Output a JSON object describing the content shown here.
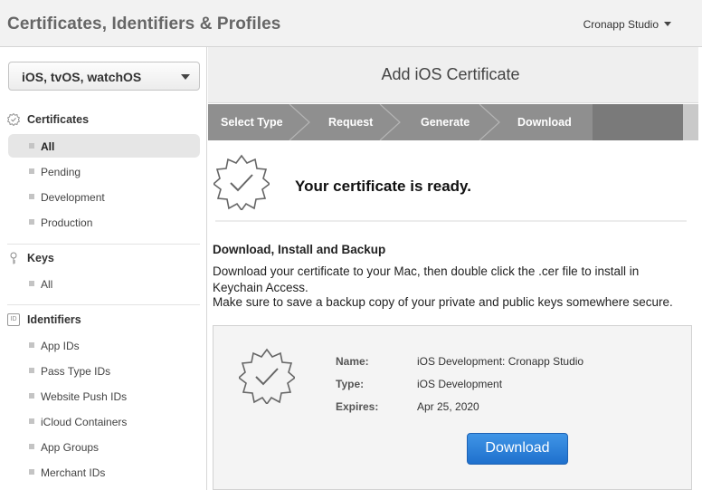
{
  "header": {
    "title": "Certificates, Identifiers & Profiles",
    "account": "Cronapp Studio"
  },
  "sidebar": {
    "platform": "iOS, tvOS, watchOS",
    "sections": {
      "certificates": {
        "title": "Certificates",
        "items": [
          "All",
          "Pending",
          "Development",
          "Production"
        ]
      },
      "keys": {
        "title": "Keys",
        "items": [
          "All"
        ]
      },
      "identifiers": {
        "title": "Identifiers",
        "icon_label": "ID",
        "items": [
          "App IDs",
          "Pass Type IDs",
          "Website Push IDs",
          "iCloud Containers",
          "App Groups",
          "Merchant IDs"
        ]
      }
    }
  },
  "main": {
    "title": "Add iOS Certificate",
    "steps": [
      "Select Type",
      "Request",
      "Generate",
      "Download"
    ],
    "ready": "Your certificate is ready.",
    "section_title": "Download, Install and Backup",
    "paragraph1": "Download your certificate to your Mac, then double click the .cer file to install in Keychain Access.",
    "paragraph2": "Make sure to save a backup copy of your private and public keys somewhere secure.",
    "certificate": {
      "name_label": "Name:",
      "name_value": "iOS Development: Cronapp Studio",
      "type_label": "Type:",
      "type_value": "iOS Development",
      "expires_label": "Expires:",
      "expires_value": "Apr 25, 2020"
    },
    "download_label": "Download"
  },
  "colors": {
    "accent": "#2277d4",
    "steps_done": "#8f8f8f",
    "steps_current": "#7a7a7a",
    "steps_pending": "#c9c9c9"
  }
}
